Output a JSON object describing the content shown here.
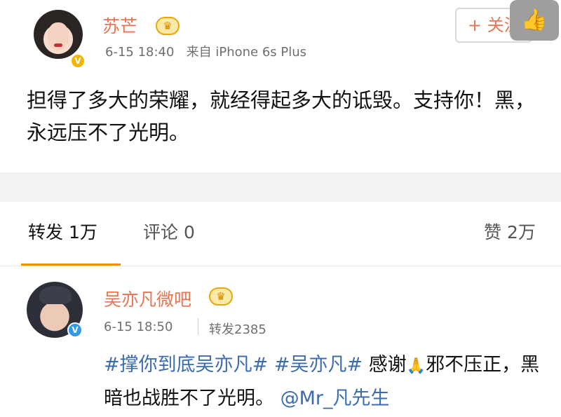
{
  "post": {
    "author_name": "苏芒",
    "timestamp": "6-15 18:40",
    "source": "来自 iPhone 6s Plus",
    "follow_label": "+ 关注",
    "text": "担得了多大的荣耀，就经得起多大的诋毁。支持你！黑，永远压不了光明。"
  },
  "tabs": {
    "repost": "转发 1万",
    "comment": "评论 0",
    "like": "赞 2万"
  },
  "repost_item": {
    "author_name": "吴亦凡微吧",
    "timestamp": "6-15 18:50",
    "repost_count": "转发2385",
    "text_hashtag1": "#撑你到底吴亦凡#",
    "text_hashtag2": "#吴亦凡#",
    "text_body1": "感谢",
    "text_emoji": "🙏",
    "text_body2": "邪不压正，黑暗也战胜不了光明。",
    "text_mention": "@Mr_凡先生"
  },
  "icons": {
    "verified": "verified-icon",
    "crown": "vip-crown-icon",
    "thumb": "thumb-up-icon"
  },
  "colors": {
    "name": "#eb7350",
    "accent_underline": "#f29100",
    "link": "#3b6cb3"
  }
}
